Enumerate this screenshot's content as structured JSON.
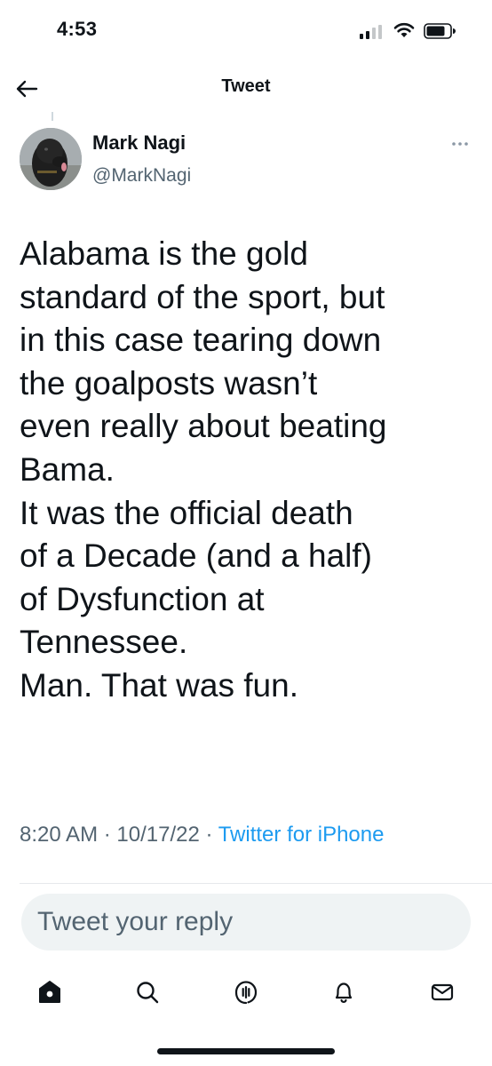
{
  "status_bar": {
    "time": "4:53"
  },
  "header": {
    "title": "Tweet",
    "back_icon": "arrow-left-icon"
  },
  "tweet": {
    "author_name": "Mark Nagi",
    "author_handle": "@MarkNagi",
    "text_lines": [
      "Alabama is the gold",
      "standard of the sport, but",
      "in this case tearing down",
      "the goalposts wasn’t",
      "even really about beating",
      "Bama.",
      "It was the official death",
      "of a Decade (and a half)",
      "of Dysfunction at",
      "Tennessee.",
      "Man. That was fun."
    ],
    "time": "8:20 AM",
    "date": "10/17/22",
    "separator": " · ",
    "source": "Twitter for iPhone"
  },
  "reply": {
    "placeholder": "Tweet your reply"
  },
  "tab_bar": {
    "items": [
      {
        "icon": "home-icon"
      },
      {
        "icon": "search-icon"
      },
      {
        "icon": "spaces-icon"
      },
      {
        "icon": "notifications-icon"
      },
      {
        "icon": "messages-icon"
      }
    ]
  },
  "colors": {
    "text": "#0f1419",
    "secondary": "#536471",
    "accent": "#1d9bf0",
    "reply_bg": "#eff3f4"
  }
}
